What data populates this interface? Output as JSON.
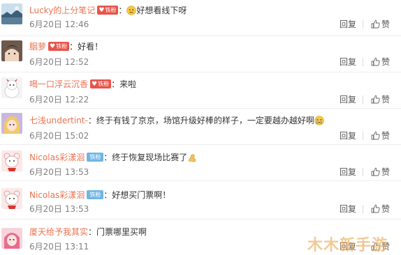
{
  "comments": [
    {
      "username": "Lucky的上分笔记",
      "badge": "铁粉",
      "badge_style": "red",
      "text": "好想看线下呀",
      "emoji": "sad-face-emoji",
      "time": "6月20日 12:46",
      "reply": "回复",
      "like": "赞",
      "avatar": "avatar-landscape"
    },
    {
      "username": "胭萝",
      "badge": "铁粉",
      "badge_style": "red",
      "text": "好看！",
      "emoji": "",
      "time": "6月20日 12:52",
      "reply": "回复",
      "like": "赞",
      "avatar": "avatar-anime-boy"
    },
    {
      "username": "喝一口浮云沉香",
      "badge": "铁粉",
      "badge_style": "red",
      "text": "来啦",
      "emoji": "",
      "time": "6月20日 12:22",
      "reply": "回复",
      "like": "赞",
      "avatar": "avatar-character"
    },
    {
      "username": "七浅undertint-",
      "badge": "",
      "badge_style": "",
      "text": "终于有钱了京京，场馆升级好棒的样子，一定要越办越好啊",
      "emoji": "crying-face-emoji",
      "time": "6月20日 15:02",
      "reply": "回复",
      "like": "赞",
      "avatar": "avatar-anime-girl"
    },
    {
      "username": "Nicolas彩漾洄",
      "badge": "铁粉",
      "badge_style": "blue",
      "text": "终于恢复现场比赛了",
      "emoji": "flexed-arm-emoji",
      "time": "6月20日 13:53",
      "reply": "回复",
      "like": "赞",
      "avatar": "avatar-teddy-bear"
    },
    {
      "username": "Nicolas彩漾洄",
      "badge": "铁粉",
      "badge_style": "blue",
      "text": "好想买门票啊！",
      "emoji": "",
      "time": "6月20日 13:53",
      "reply": "回复",
      "like": "赞",
      "avatar": "avatar-teddy-bear"
    },
    {
      "username": "厦天给予我其实",
      "badge": "",
      "badge_style": "",
      "text": "门票哪里买啊",
      "emoji": "",
      "time": "6月20日 13:11",
      "reply": "回复",
      "like": "赞",
      "avatar": "avatar-anime-pink"
    }
  ],
  "watermark": "木木新手游",
  "colors": {
    "username": "#eb7350",
    "time": "#808080",
    "badge_red": "#e8544a",
    "badge_blue": "#6fb6e6"
  }
}
